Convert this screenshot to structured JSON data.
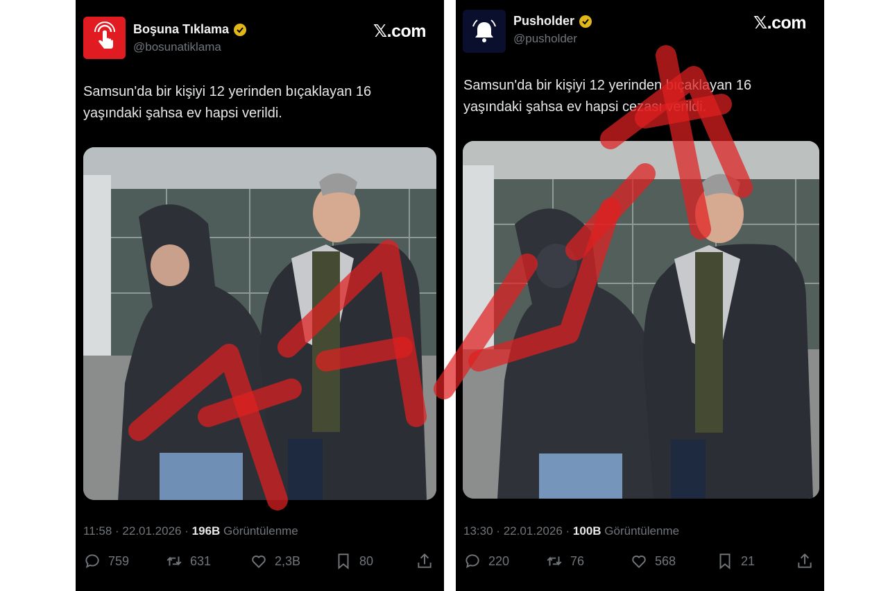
{
  "tweets": [
    {
      "display_name": "Boşuna Tıklama",
      "handle": "@bosunatiklama",
      "site": "𝕏.com",
      "text": "Samsun'da bir kişiyi 12 yerinden bıçaklayan 16 yaşındaki şahsa ev hapsi verildi.",
      "time": "11:58",
      "date": "22.01.2026",
      "views": "196B",
      "views_label": "Görüntülenme",
      "replies": "759",
      "reposts": "631",
      "likes": "2,3B",
      "bookmarks": "80",
      "avatar_icon": "tap-finger-icon",
      "avatar_color": "#e01b22"
    },
    {
      "display_name": "Pusholder",
      "handle": "@pusholder",
      "site": "𝕏.com",
      "text": "Samsun'da bir kişiyi 12 yerinden bıçaklayan 16 yaşındaki şahsa ev hapsi cezası verildi.",
      "time": "13:30",
      "date": "22.01.2026",
      "views": "100B",
      "views_label": "Görüntülenme",
      "replies": "220",
      "reposts": "76",
      "likes": "568",
      "bookmarks": "21",
      "avatar_icon": "bell-icon",
      "avatar_color": "#0b0f2e"
    }
  ],
  "colors": {
    "background": "#000000",
    "text": "#e7e9ea",
    "muted": "#71767b",
    "verified_badge": "#e2b719",
    "stamp": "#e02020"
  }
}
